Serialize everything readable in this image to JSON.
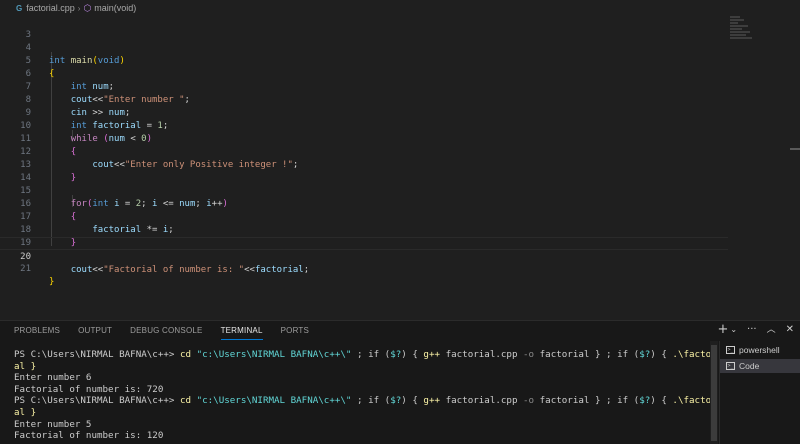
{
  "breadcrumb": {
    "file": "factorial.cpp",
    "symbol": "main(void)"
  },
  "editor": {
    "lines": [
      {
        "n": "3"
      },
      {
        "n": "4"
      },
      {
        "n": "5"
      },
      {
        "n": "6"
      },
      {
        "n": "7"
      },
      {
        "n": "8"
      },
      {
        "n": "9"
      },
      {
        "n": "10"
      },
      {
        "n": "11"
      },
      {
        "n": "12"
      },
      {
        "n": "13"
      },
      {
        "n": "14"
      },
      {
        "n": "15"
      },
      {
        "n": "16"
      },
      {
        "n": "17"
      },
      {
        "n": "18"
      },
      {
        "n": "19"
      },
      {
        "n": "20"
      },
      {
        "n": "21"
      }
    ],
    "code": {
      "int_kw": "int",
      "main_fn": "main",
      "void_kw": "void",
      "num_var": "num",
      "cout": "cout",
      "cin": "cin",
      "factorial_var": "factorial",
      "while_kw": "while",
      "for_kw": "for",
      "i_var": "i",
      "str_enter": "\"Enter number \"",
      "str_positive": "\"Enter only Positive integer !\"",
      "str_result": "\"Factorial of number is: \"",
      "one": "1",
      "zero": "0",
      "two": "2"
    },
    "active_line": "20"
  },
  "panel": {
    "tabs": [
      {
        "label": "PROBLEMS"
      },
      {
        "label": "OUTPUT"
      },
      {
        "label": "DEBUG CONSOLE"
      },
      {
        "label": "TERMINAL",
        "active": true
      },
      {
        "label": "PORTS"
      }
    ],
    "terminal": {
      "prompt": "PS C:\\Users\\NIRMAL BAFNA\\c++> ",
      "cmd_cd": "cd",
      "cmd_path": "\"c:\\Users\\NIRMAL BAFNA\\c++\\\"",
      "cmd_mid1": " ; if (",
      "cmd_q": "$?",
      "cmd_mid2": ") { ",
      "cmd_gpp": "g++",
      "cmd_file": " factorial.cpp ",
      "cmd_o": "-o",
      "cmd_mid3": " factorial } ; if (",
      "cmd_mid4": ") { ",
      "cmd_run_a": ".\\factori",
      "cmd_run_b": "al }",
      "out1a": "Enter number 6",
      "out1b": "Factorial of number is: 720",
      "out2a": "Enter number 5",
      "out2b": "Factorial of number is: 120"
    },
    "terminals": [
      {
        "label": "powershell"
      },
      {
        "label": "Code",
        "active": true
      }
    ]
  }
}
